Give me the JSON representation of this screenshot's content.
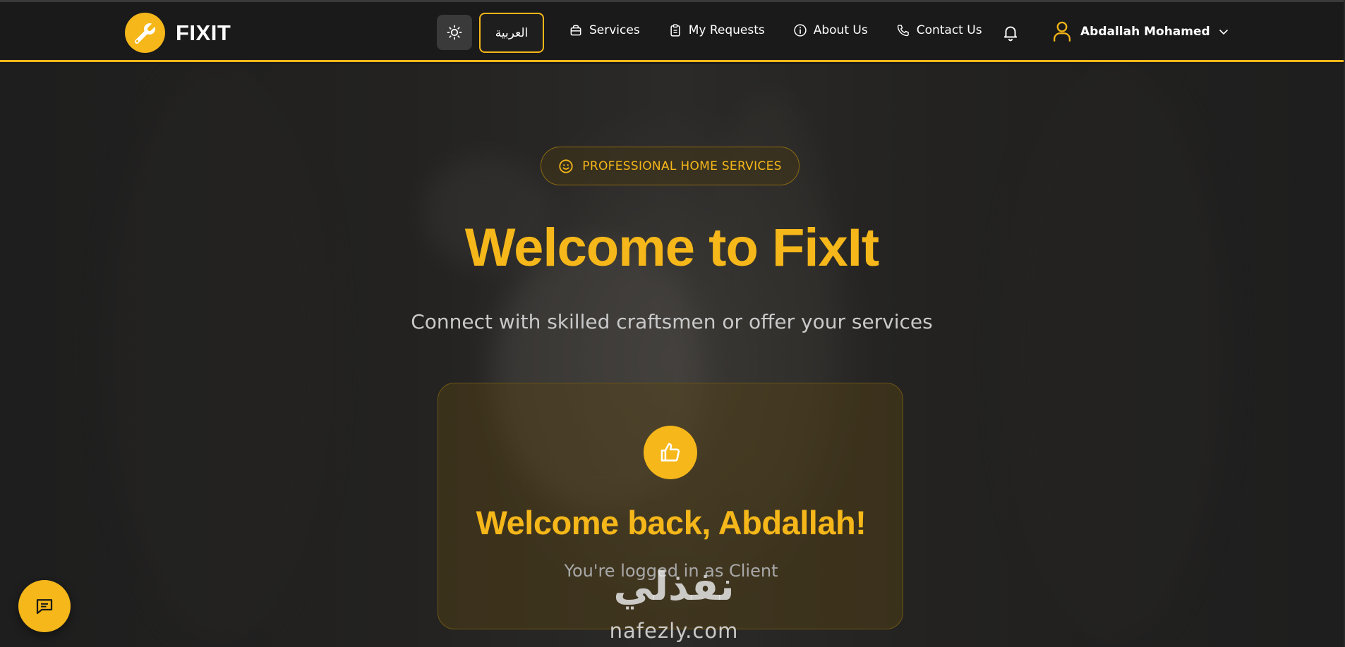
{
  "brand": {
    "name": "FIXIT"
  },
  "colors": {
    "accent": "#f5b719",
    "background": "#1c1c1c",
    "navbar": "#1a1a1a"
  },
  "nav": {
    "language_label": "العربية",
    "theme_icon": "sun-icon",
    "links": [
      {
        "label": "Services",
        "icon": "bag-icon"
      },
      {
        "label": "My Requests",
        "icon": "clipboard-icon"
      },
      {
        "label": "About Us",
        "icon": "info-icon"
      },
      {
        "label": "Contact Us",
        "icon": "phone-icon"
      }
    ],
    "notifications_icon": "bell-icon",
    "user": {
      "name": "Abdallah Mohamed",
      "icon": "user-icon"
    }
  },
  "hero": {
    "badge": "PROFESSIONAL HOME SERVICES",
    "badge_icon": "smile-icon",
    "title": "Welcome to FixIt",
    "subtitle": "Connect with skilled craftsmen or offer your services"
  },
  "welcome_card": {
    "icon": "thumbs-up-icon",
    "title": "Welcome back, Abdallah!",
    "subtitle": "You're logged in as Client"
  },
  "watermark": {
    "arabic": "نفذلي",
    "latin": "nafezly.com"
  },
  "chat_button": {
    "icon": "chat-icon"
  }
}
